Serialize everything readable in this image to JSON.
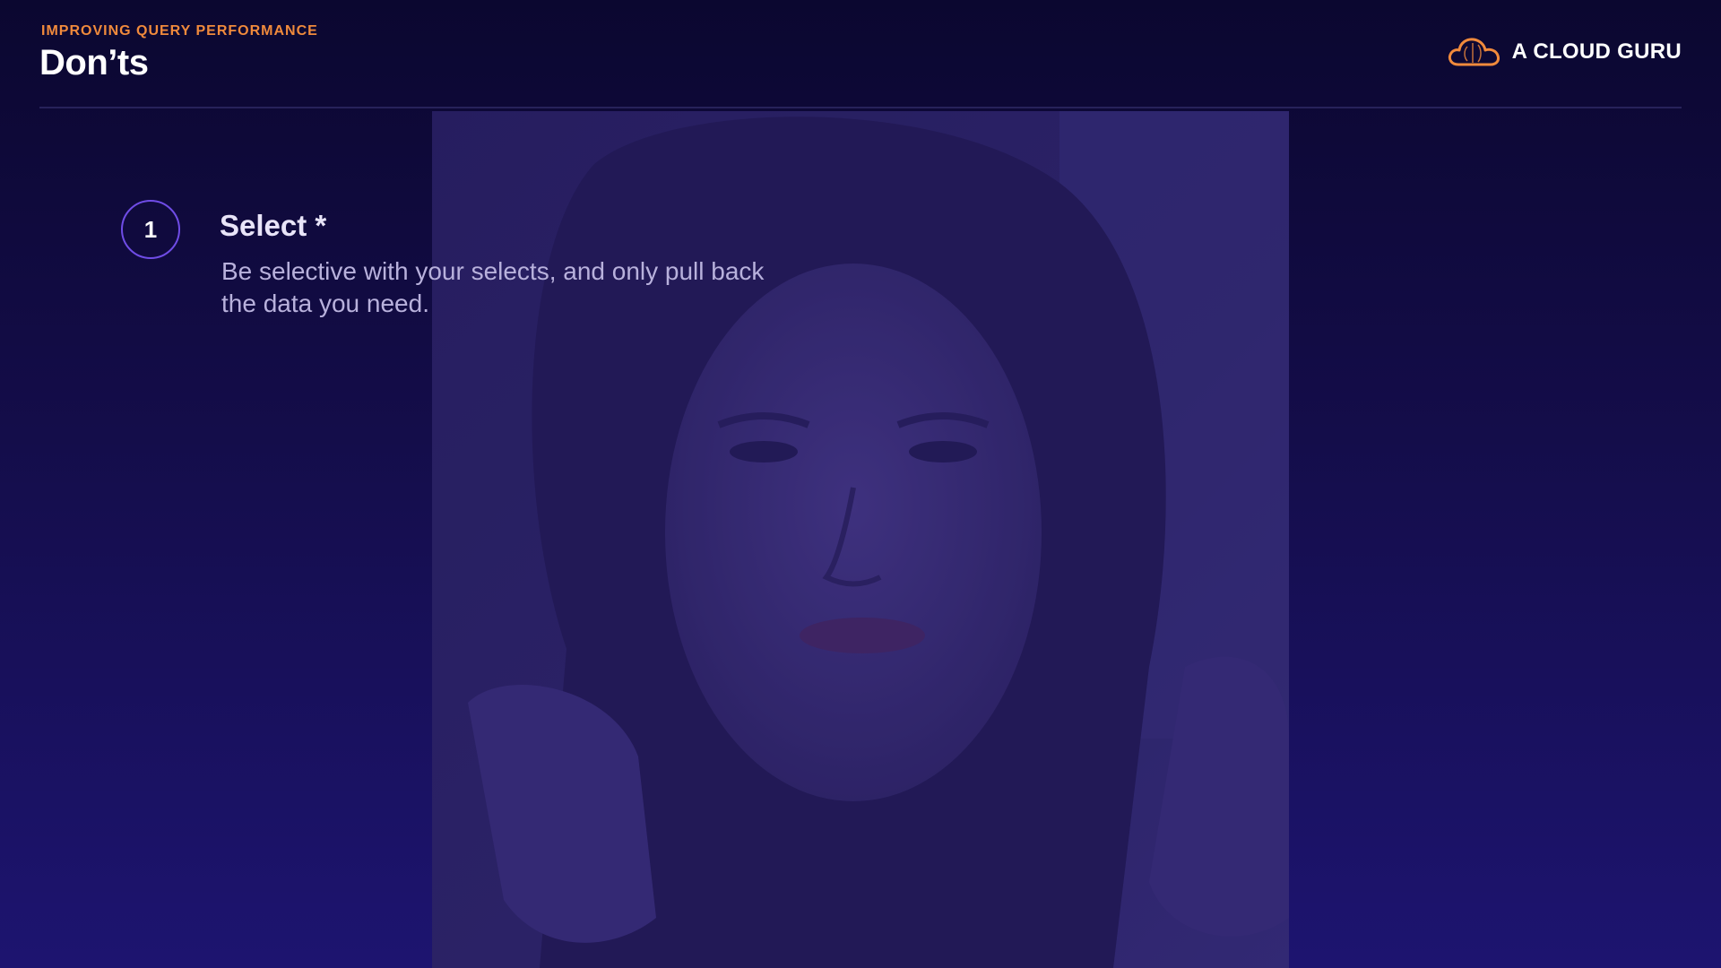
{
  "header": {
    "eyebrow": "IMPROVING QUERY PERFORMANCE",
    "title": "Don’ts"
  },
  "brand": {
    "name": "A CLOUD GURU",
    "logo_icon": "cloud-icon",
    "accent_color": "#f08a3c"
  },
  "items": [
    {
      "number": "1",
      "title": "Select *",
      "description": "Be selective with your selects, and only pull back the data you need."
    }
  ],
  "colors": {
    "background_top": "#0b0730",
    "background_bottom": "#1d1470",
    "circle_border": "#6f4ce6"
  }
}
